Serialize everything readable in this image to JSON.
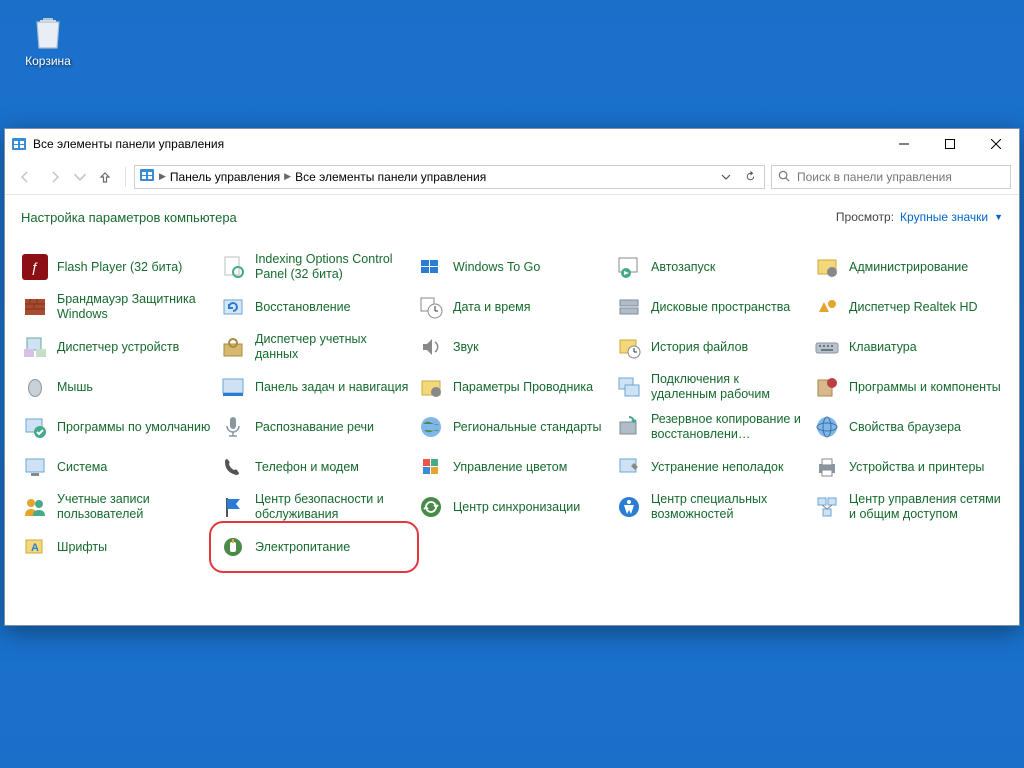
{
  "desktop": {
    "recycle_bin": "Корзина"
  },
  "window": {
    "title": "Все элементы панели управления",
    "breadcrumb": {
      "root": "Панель управления",
      "current": "Все элементы панели управления"
    },
    "search_placeholder": "Поиск в панели управления",
    "heading": "Настройка параметров компьютера",
    "view_label": "Просмотр:",
    "view_value": "Крупные значки"
  },
  "items": [
    {
      "label": "Flash Player (32 бита)"
    },
    {
      "label": "Indexing Options Control Panel (32 бита)"
    },
    {
      "label": "Windows To Go"
    },
    {
      "label": "Автозапуск"
    },
    {
      "label": "Администрирование"
    },
    {
      "label": "Брандмауэр Защитника Windows"
    },
    {
      "label": "Восстановление"
    },
    {
      "label": "Дата и время"
    },
    {
      "label": "Дисковые пространства"
    },
    {
      "label": "Диспетчер Realtek HD"
    },
    {
      "label": "Диспетчер устройств"
    },
    {
      "label": "Диспетчер учетных данных"
    },
    {
      "label": "Звук"
    },
    {
      "label": "История файлов"
    },
    {
      "label": "Клавиатура"
    },
    {
      "label": "Мышь"
    },
    {
      "label": "Панель задач и навигация"
    },
    {
      "label": "Параметры Проводника"
    },
    {
      "label": "Подключения к удаленным рабочим"
    },
    {
      "label": "Программы и компоненты"
    },
    {
      "label": "Программы по умолчанию"
    },
    {
      "label": "Распознавание речи"
    },
    {
      "label": "Региональные стандарты"
    },
    {
      "label": "Резервное копирование и восстановлени…"
    },
    {
      "label": "Свойства браузера"
    },
    {
      "label": "Система"
    },
    {
      "label": "Телефон и модем"
    },
    {
      "label": "Управление цветом"
    },
    {
      "label": "Устранение неполадок"
    },
    {
      "label": "Устройства и принтеры"
    },
    {
      "label": "Учетные записи пользователей"
    },
    {
      "label": "Центр безопасности и обслуживания"
    },
    {
      "label": "Центр синхронизации"
    },
    {
      "label": "Центр специальных возможностей"
    },
    {
      "label": "Центр управления сетями и общим доступом"
    },
    {
      "label": "Шрифты"
    },
    {
      "label": "Электропитание"
    }
  ]
}
